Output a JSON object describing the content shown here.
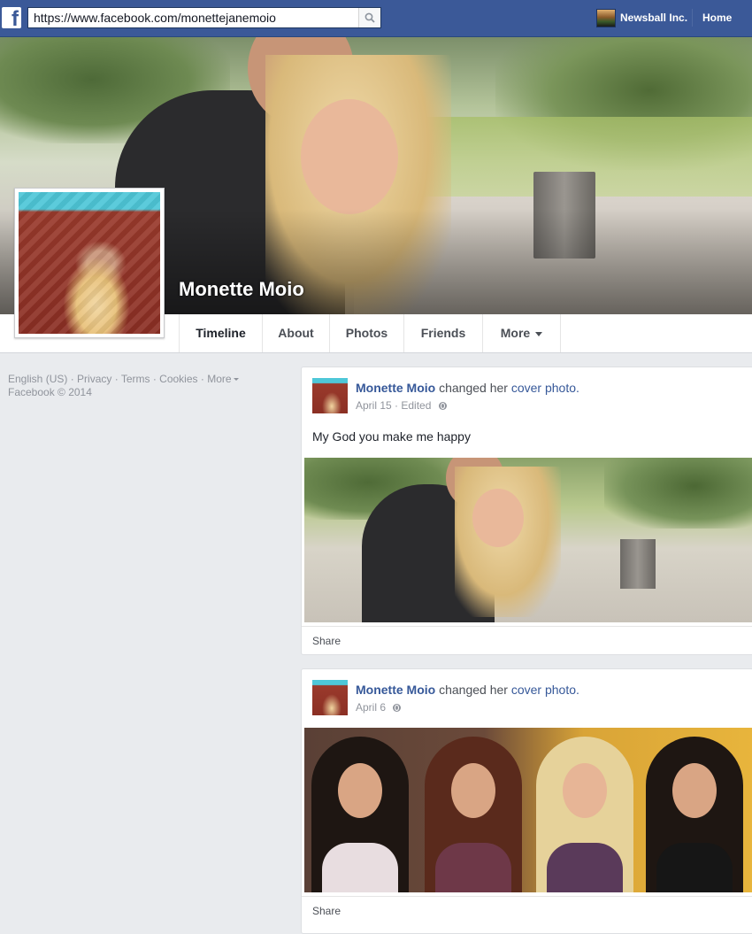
{
  "browser": {
    "url": "https://www.facebook.com/monettejanemoio"
  },
  "topbar": {
    "logo_letter": "f",
    "page_name": "Newsball Inc.",
    "home_label": "Home"
  },
  "profile": {
    "name": "Monette Moio"
  },
  "tabs": [
    {
      "label": "Timeline",
      "active": true
    },
    {
      "label": "About",
      "active": false
    },
    {
      "label": "Photos",
      "active": false
    },
    {
      "label": "Friends",
      "active": false
    },
    {
      "label": "More",
      "active": false
    }
  ],
  "footer": {
    "links": [
      "English (US)",
      "Privacy",
      "Terms",
      "Cookies",
      "More"
    ],
    "separator": " · ",
    "copyright": "Facebook © 2014"
  },
  "posts": [
    {
      "author": "Monette Moio",
      "action": "changed her",
      "object": "cover photo.",
      "date": "April 15",
      "edited": "Edited",
      "text": "My God you make me happy",
      "share_label": "Share"
    },
    {
      "author": "Monette Moio",
      "action": "changed her",
      "object": "cover photo.",
      "date": "April 6",
      "share_label": "Share"
    }
  ],
  "colors": {
    "brand_blue": "#3b5998",
    "link_blue": "#365899",
    "page_background": "#e9ebee"
  },
  "icons": [
    "facebook-logo-icon",
    "search-icon",
    "chevron-down-icon",
    "globe-icon"
  ]
}
